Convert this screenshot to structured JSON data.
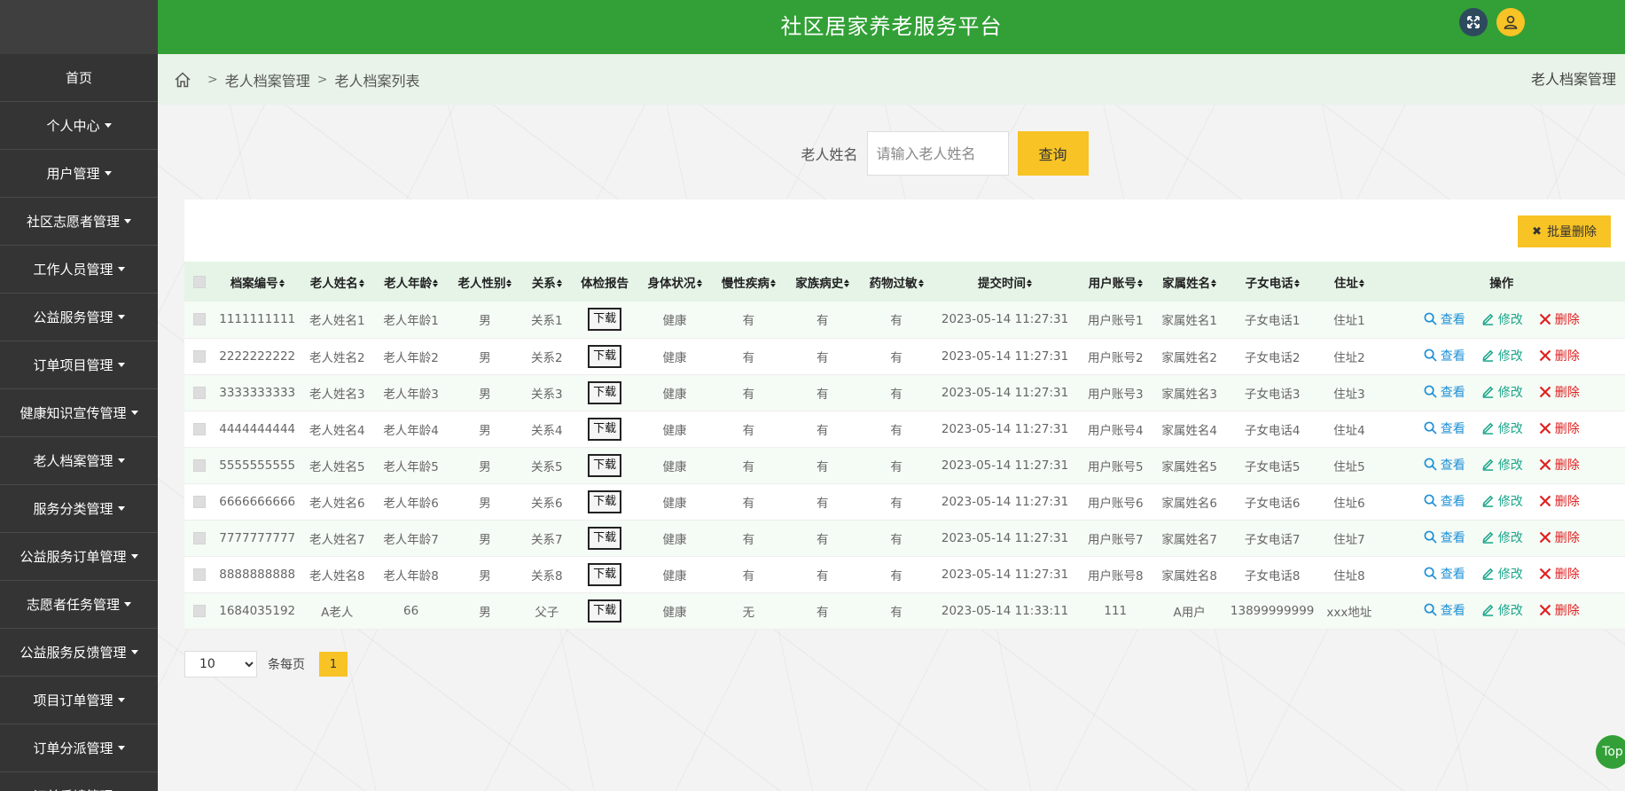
{
  "header": {
    "title": "社区居家养老服务平台"
  },
  "sidebar": {
    "items": [
      {
        "label": "首页",
        "caret": false
      },
      {
        "label": "个人中心",
        "caret": true
      },
      {
        "label": "用户管理",
        "caret": true
      },
      {
        "label": "社区志愿者管理",
        "caret": true
      },
      {
        "label": "工作人员管理",
        "caret": true
      },
      {
        "label": "公益服务管理",
        "caret": true
      },
      {
        "label": "订单项目管理",
        "caret": true
      },
      {
        "label": "健康知识宣传管理",
        "caret": true
      },
      {
        "label": "老人档案管理",
        "caret": true
      },
      {
        "label": "服务分类管理",
        "caret": true
      },
      {
        "label": "公益服务订单管理",
        "caret": true
      },
      {
        "label": "志愿者任务管理",
        "caret": true
      },
      {
        "label": "公益服务反馈管理",
        "caret": true
      },
      {
        "label": "项目订单管理",
        "caret": true
      },
      {
        "label": "订单分派管理",
        "caret": true
      },
      {
        "label": "订单反馈管理",
        "caret": true
      }
    ]
  },
  "breadcrumb": {
    "items": [
      "老人档案管理",
      "老人档案列表"
    ],
    "separator": ">",
    "right_title": "老人档案管理"
  },
  "search": {
    "label": "老人姓名",
    "placeholder": "请输入老人姓名",
    "button": "查询"
  },
  "batch_delete": {
    "icon": "✖",
    "label": "批量删除"
  },
  "table": {
    "columns": [
      {
        "label": "档案编号",
        "sortable": true
      },
      {
        "label": "老人姓名",
        "sortable": true
      },
      {
        "label": "老人年龄",
        "sortable": true
      },
      {
        "label": "老人性别",
        "sortable": true
      },
      {
        "label": "关系",
        "sortable": true
      },
      {
        "label": "体检报告",
        "sortable": false
      },
      {
        "label": "身体状况",
        "sortable": true
      },
      {
        "label": "慢性疾病",
        "sortable": true
      },
      {
        "label": "家族病史",
        "sortable": true
      },
      {
        "label": "药物过敏",
        "sortable": true
      },
      {
        "label": "提交时间",
        "sortable": true
      },
      {
        "label": "用户账号",
        "sortable": true
      },
      {
        "label": "家属姓名",
        "sortable": true
      },
      {
        "label": "子女电话",
        "sortable": true
      },
      {
        "label": "住址",
        "sortable": true
      },
      {
        "label": "操作",
        "sortable": false
      }
    ],
    "download_label": "下载",
    "actions": {
      "view": "查看",
      "edit": "修改",
      "delete": "删除"
    },
    "rows": [
      [
        "1111111111",
        "老人姓名1",
        "老人年龄1",
        "男",
        "关系1",
        "健康",
        "有",
        "有",
        "有",
        "2023-05-14 11:27:31",
        "用户账号1",
        "家属姓名1",
        "子女电话1",
        "住址1"
      ],
      [
        "2222222222",
        "老人姓名2",
        "老人年龄2",
        "男",
        "关系2",
        "健康",
        "有",
        "有",
        "有",
        "2023-05-14 11:27:31",
        "用户账号2",
        "家属姓名2",
        "子女电话2",
        "住址2"
      ],
      [
        "3333333333",
        "老人姓名3",
        "老人年龄3",
        "男",
        "关系3",
        "健康",
        "有",
        "有",
        "有",
        "2023-05-14 11:27:31",
        "用户账号3",
        "家属姓名3",
        "子女电话3",
        "住址3"
      ],
      [
        "4444444444",
        "老人姓名4",
        "老人年龄4",
        "男",
        "关系4",
        "健康",
        "有",
        "有",
        "有",
        "2023-05-14 11:27:31",
        "用户账号4",
        "家属姓名4",
        "子女电话4",
        "住址4"
      ],
      [
        "5555555555",
        "老人姓名5",
        "老人年龄5",
        "男",
        "关系5",
        "健康",
        "有",
        "有",
        "有",
        "2023-05-14 11:27:31",
        "用户账号5",
        "家属姓名5",
        "子女电话5",
        "住址5"
      ],
      [
        "6666666666",
        "老人姓名6",
        "老人年龄6",
        "男",
        "关系6",
        "健康",
        "有",
        "有",
        "有",
        "2023-05-14 11:27:31",
        "用户账号6",
        "家属姓名6",
        "子女电话6",
        "住址6"
      ],
      [
        "7777777777",
        "老人姓名7",
        "老人年龄7",
        "男",
        "关系7",
        "健康",
        "有",
        "有",
        "有",
        "2023-05-14 11:27:31",
        "用户账号7",
        "家属姓名7",
        "子女电话7",
        "住址7"
      ],
      [
        "8888888888",
        "老人姓名8",
        "老人年龄8",
        "男",
        "关系8",
        "健康",
        "有",
        "有",
        "有",
        "2023-05-14 11:27:31",
        "用户账号8",
        "家属姓名8",
        "子女电话8",
        "住址8"
      ],
      [
        "1684035192",
        "A老人",
        "66",
        "男",
        "父子",
        "健康",
        "无",
        "有",
        "有",
        "2023-05-14 11:33:11",
        "111",
        "A用户",
        "13899999999",
        "xxx地址"
      ]
    ]
  },
  "pagination": {
    "page_size": "10",
    "page_size_options": [
      "10"
    ],
    "per_page_label": "条每页",
    "current_page": "1"
  },
  "back_to_top": "Top",
  "colors": {
    "header_green": "#32a036",
    "accent_yellow": "#f7c325",
    "sidebar_dark": "#343434",
    "view_blue": "#1e90d6",
    "edit_teal": "#1aa58a",
    "delete_red": "#e02020"
  },
  "icons": {
    "home": "home-icon",
    "fullscreen": "expand-icon",
    "user": "user-icon",
    "view": "search-icon",
    "edit": "pencil-icon",
    "delete": "close-icon"
  }
}
